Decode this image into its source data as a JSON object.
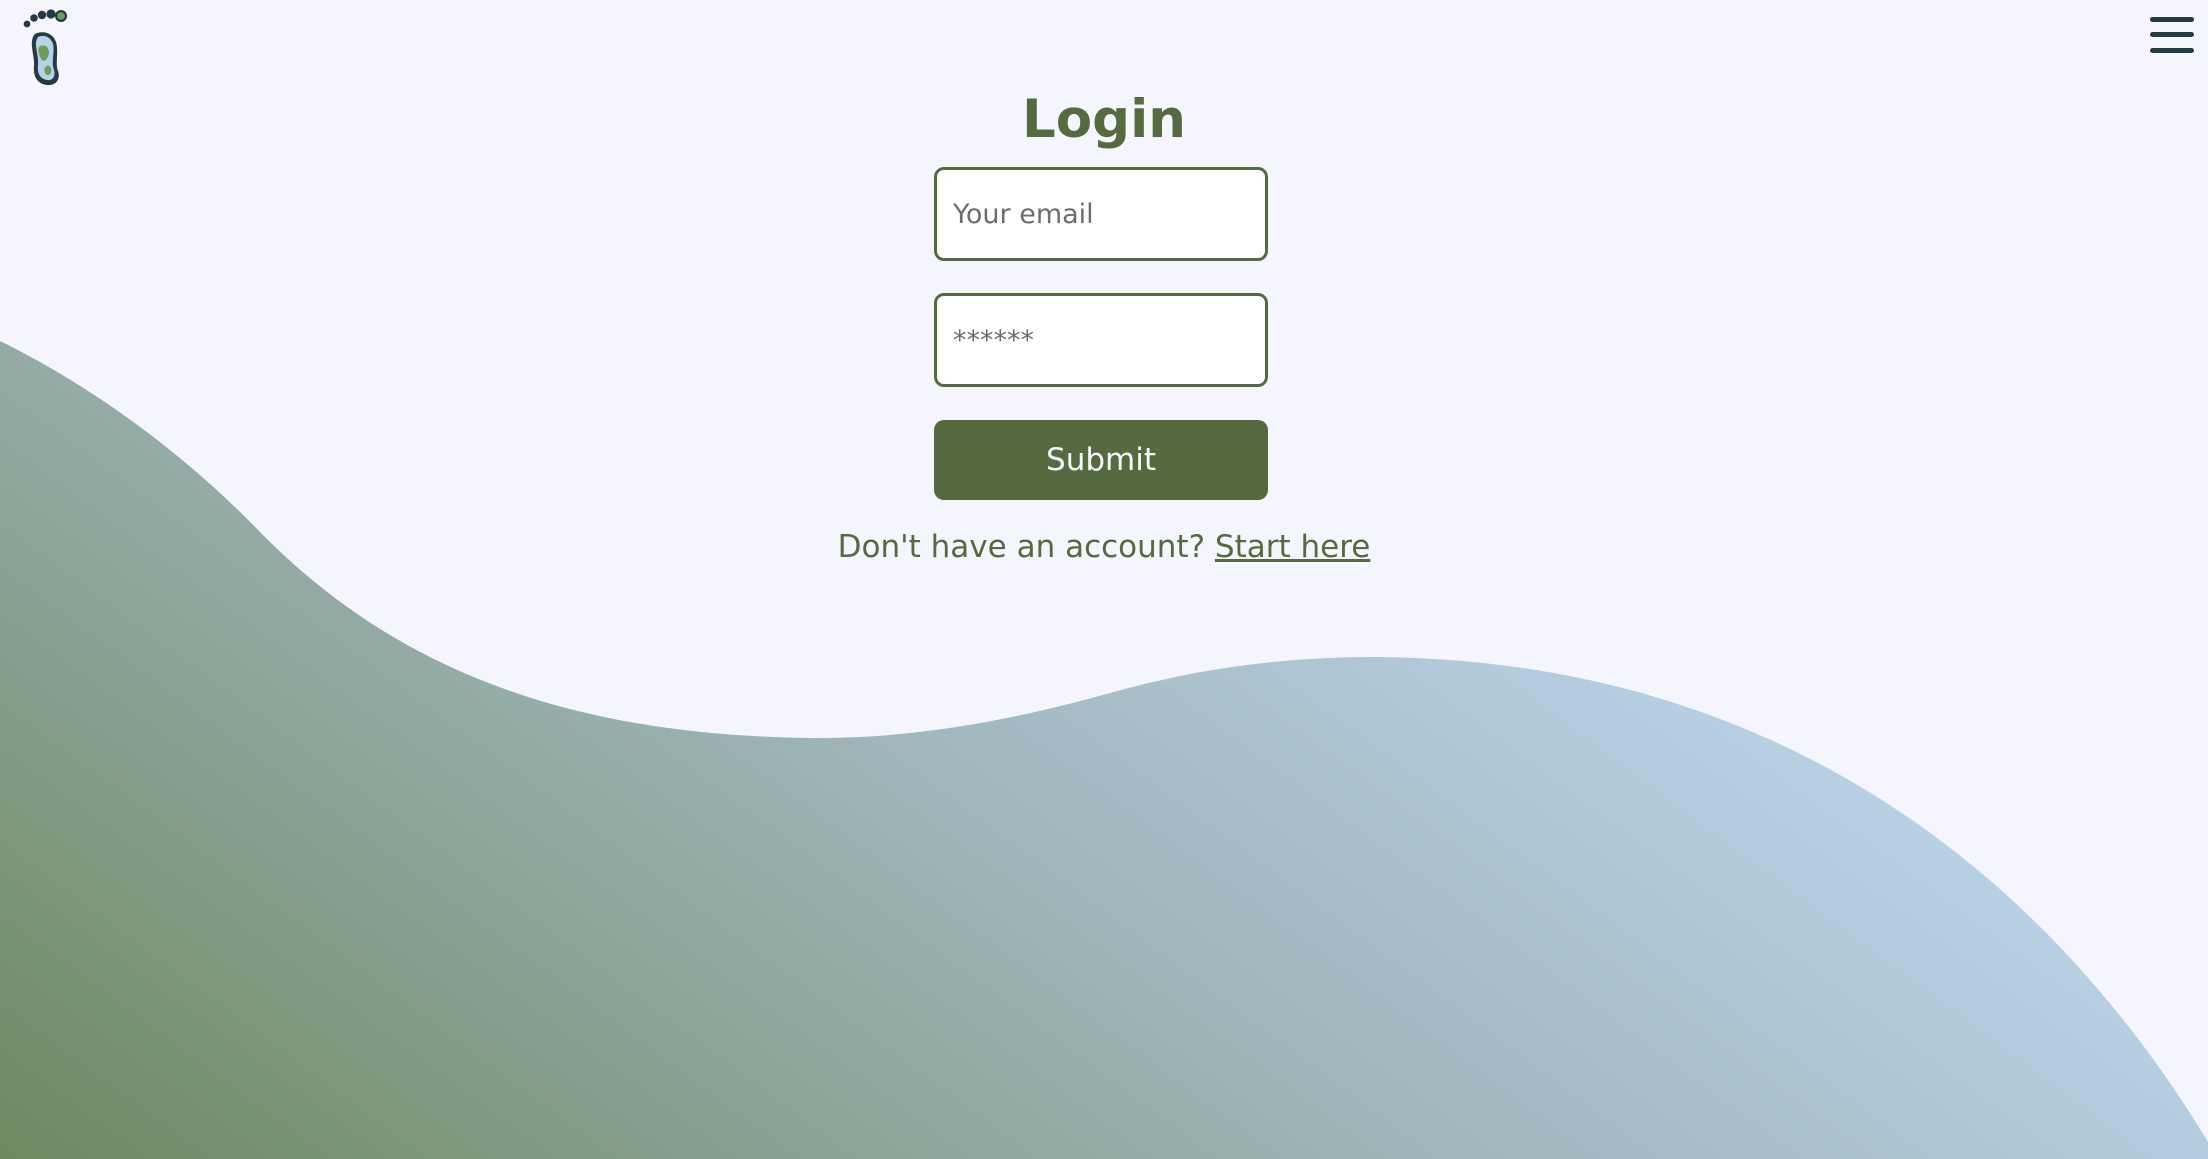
{
  "header": {
    "logo_icon": "footprint-logo-icon",
    "menu_icon": "hamburger-menu-icon"
  },
  "login": {
    "title": "Login",
    "email_placeholder": "Your email",
    "email_value": "",
    "password_placeholder": "******",
    "password_value": "",
    "submit_label": "Submit",
    "signup_prompt": "Don't have an account?",
    "signup_link": "Start here"
  },
  "colors": {
    "background": "#f5f6fd",
    "brand_green": "#556b3f",
    "wave_gradient_start": "#6e8861",
    "wave_gradient_end": "#bed6ef",
    "menu_icon": "#263a46"
  }
}
